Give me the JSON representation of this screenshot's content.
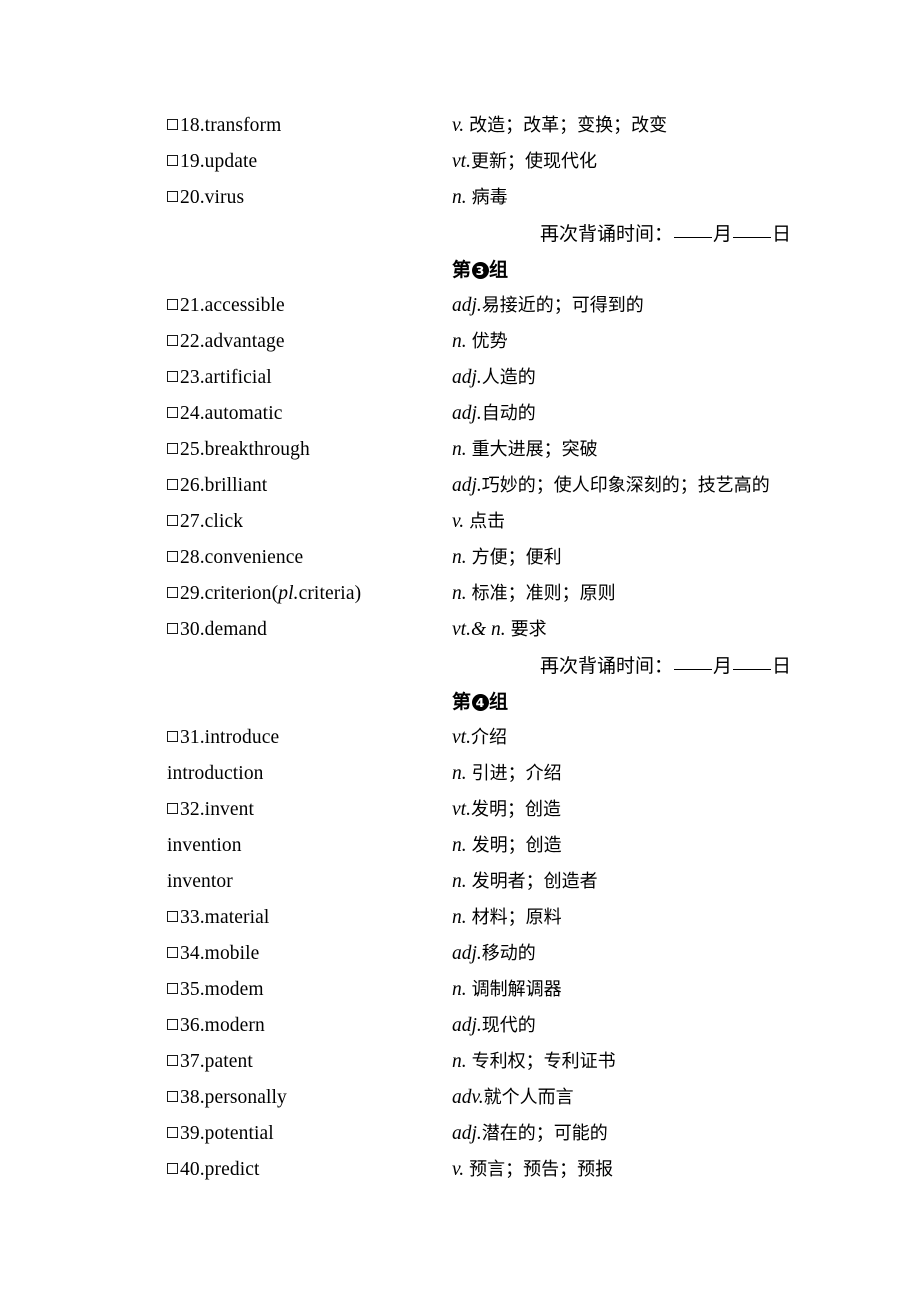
{
  "document": {
    "type": "vocabulary-memorization-worksheet",
    "recite_label": "再次背诵时间：",
    "month_char": "月",
    "day_char": "日",
    "group_prefix": "第",
    "group_suffix": "组"
  },
  "blocks": [
    {
      "kind": "words",
      "entries": [
        {
          "checkbox": true,
          "number": "18.",
          "word": "transform",
          "pos": "v.",
          "pos_wide": true,
          "definition": "改造；改革；变换；改变"
        },
        {
          "checkbox": true,
          "number": "19.",
          "word": "update",
          "pos": "vt.",
          "pos_wide": false,
          "definition": "更新；使现代化"
        },
        {
          "checkbox": true,
          "number": "20.",
          "word": "virus",
          "pos": "n.",
          "pos_wide": true,
          "definition": "病毒"
        }
      ]
    },
    {
      "kind": "recite",
      "label": "再次背诵时间：",
      "month": "月",
      "day": "日"
    },
    {
      "kind": "group-header",
      "prefix": "第",
      "num": "3",
      "suffix": "组"
    },
    {
      "kind": "words",
      "entries": [
        {
          "checkbox": true,
          "number": "21.",
          "word": "accessible",
          "pos": "adj.",
          "pos_wide": false,
          "definition": "易接近的；可得到的"
        },
        {
          "checkbox": true,
          "number": "22.",
          "word": "advantage",
          "pos": "n.",
          "pos_wide": true,
          "definition": "优势"
        },
        {
          "checkbox": true,
          "number": "23.",
          "word": "artificial",
          "pos": "adj.",
          "pos_wide": false,
          "definition": "人造的"
        },
        {
          "checkbox": true,
          "number": "24.",
          "word": "automatic",
          "pos": "adj.",
          "pos_wide": false,
          "definition": "自动的"
        },
        {
          "checkbox": true,
          "number": "25.",
          "word": "breakthrough",
          "pos": "n.",
          "pos_wide": true,
          "definition": "重大进展；突破"
        },
        {
          "checkbox": true,
          "number": "26.",
          "word": "brilliant",
          "pos": "adj.",
          "pos_wide": false,
          "definition": "巧妙的；使人印象深刻的；技艺高的"
        },
        {
          "checkbox": true,
          "number": "27.",
          "word": "click",
          "pos": "v.",
          "pos_wide": true,
          "definition": "点击"
        },
        {
          "checkbox": true,
          "number": "28.",
          "word": "convenience",
          "pos": "n.",
          "pos_wide": true,
          "definition": "方便；便利"
        },
        {
          "checkbox": true,
          "number": "29.",
          "word": "criterion(",
          "word_italic": "pl.",
          "word_tail": "criteria)",
          "pos": "n.",
          "pos_wide": true,
          "definition": "标准；准则；原则"
        },
        {
          "checkbox": true,
          "number": "30.",
          "word": "demand",
          "pos": "vt.& n.",
          "pos_wide": true,
          "definition": "要求"
        }
      ]
    },
    {
      "kind": "recite",
      "label": "再次背诵时间：",
      "month": "月",
      "day": "日"
    },
    {
      "kind": "group-header",
      "prefix": "第",
      "num": "4",
      "suffix": "组"
    },
    {
      "kind": "words",
      "entries": [
        {
          "checkbox": true,
          "number": "31.",
          "word": "introduce",
          "pos": "vt.",
          "pos_wide": false,
          "definition": "介绍"
        },
        {
          "checkbox": false,
          "number": "",
          "word": "introduction",
          "pos": "n.",
          "pos_wide": true,
          "definition": "引进；介绍"
        },
        {
          "checkbox": true,
          "number": "32.",
          "word": "invent",
          "pos": "vt.",
          "pos_wide": false,
          "definition": "发明；创造"
        },
        {
          "checkbox": false,
          "number": "",
          "word": "invention",
          "pos": "n.",
          "pos_wide": true,
          "definition": "发明；创造"
        },
        {
          "checkbox": false,
          "number": "",
          "word": "inventor",
          "pos": "n.",
          "pos_wide": true,
          "definition": "发明者；创造者"
        },
        {
          "checkbox": true,
          "number": "33.",
          "word": "material",
          "pos": "n.",
          "pos_wide": true,
          "definition": "材料；原料"
        },
        {
          "checkbox": true,
          "number": "34.",
          "word": "mobile",
          "pos": "adj.",
          "pos_wide": false,
          "definition": "移动的"
        },
        {
          "checkbox": true,
          "number": "35.",
          "word": "modem",
          "pos": "n.",
          "pos_wide": true,
          "definition": "调制解调器"
        },
        {
          "checkbox": true,
          "number": "36.",
          "word": "modern",
          "pos": "adj.",
          "pos_wide": false,
          "definition": "现代的"
        },
        {
          "checkbox": true,
          "number": "37.",
          "word": "patent",
          "pos": "n.",
          "pos_wide": true,
          "definition": "专利权；专利证书"
        },
        {
          "checkbox": true,
          "number": "38.",
          "word": "personally",
          "pos": "adv.",
          "pos_wide": false,
          "definition": "就个人而言"
        },
        {
          "checkbox": true,
          "number": "39.",
          "word": "potential",
          "pos": "adj.",
          "pos_wide": false,
          "definition": "潜在的；可能的"
        },
        {
          "checkbox": true,
          "number": "40.",
          "word": "predict",
          "pos": "v.",
          "pos_wide": true,
          "definition": "预言；预告；预报"
        }
      ]
    }
  ]
}
